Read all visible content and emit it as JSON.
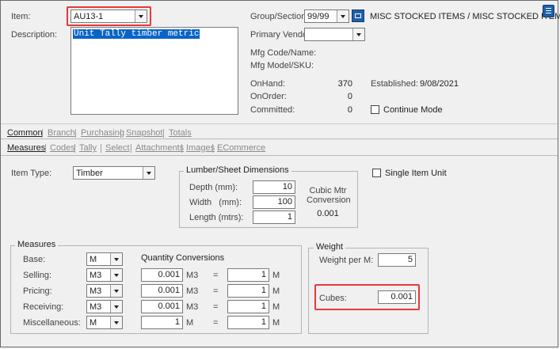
{
  "header": {
    "item_label": "Item:",
    "item_value": "AU13-1",
    "description_label": "Description:",
    "description_value": "Unit Tally timber metric",
    "group_label": "Group/Section:",
    "group_value": "99/99",
    "group_text": "MISC STOCKED ITEMS / MISC STOCKED ITEMS",
    "vendor_label": "Primary Vendor:",
    "vendor_value": "",
    "mfg_code_label": "Mfg Code/Name:",
    "mfg_model_label": "Mfg Model/SKU:",
    "onhand_label": "OnHand:",
    "onhand_value": "370",
    "onorder_label": "OnOrder:",
    "onorder_value": "0",
    "committed_label": "Committed:",
    "committed_value": "0",
    "established_label": "Established:",
    "established_value": "9/08/2021",
    "continue_mode_label": "Continue Mode"
  },
  "tabs_main": [
    "Common",
    "Branch",
    "Purchasing",
    "Snapshot",
    "Totals"
  ],
  "tabs_sub": [
    "Measures",
    "Codes",
    "Tally",
    "Select",
    "Attachments",
    "Images",
    "ECommerce"
  ],
  "item_type": {
    "label": "Item Type:",
    "value": "Timber"
  },
  "single_item_unit_label": "Single Item Unit",
  "lumber": {
    "title": "Lumber/Sheet Dimensions",
    "depth_label": "Depth (mm):",
    "depth_value": "10",
    "width_label": "Width   (mm):",
    "width_value": "100",
    "length_label": "Length (mtrs):",
    "length_value": "1",
    "cubic_label_1": "Cubic Mtr",
    "cubic_label_2": "Conversion",
    "cubic_value": "0.001"
  },
  "measures": {
    "title": "Measures",
    "qty_conv_label": "Quantity Conversions",
    "rows": [
      {
        "label": "Base:",
        "unit": "M",
        "qty": "",
        "qty_unit": "",
        "eq": "",
        "conv": "",
        "conv_unit": ""
      },
      {
        "label": "Selling:",
        "unit": "M3",
        "qty": "0.001",
        "qty_unit": "M3",
        "eq": "=",
        "conv": "1",
        "conv_unit": "M"
      },
      {
        "label": "Pricing:",
        "unit": "M3",
        "qty": "0.001",
        "qty_unit": "M3",
        "eq": "=",
        "conv": "1",
        "conv_unit": "M"
      },
      {
        "label": "Receiving:",
        "unit": "M3",
        "qty": "0.001",
        "qty_unit": "M3",
        "eq": "=",
        "conv": "1",
        "conv_unit": "M"
      },
      {
        "label": "Miscellaneous:",
        "unit": "M",
        "qty": "1",
        "qty_unit": "M",
        "eq": "=",
        "conv": "1",
        "conv_unit": "M"
      }
    ]
  },
  "weight": {
    "title": "Weight",
    "per_label": "Weight per M:",
    "per_value": "5",
    "cubes_label": "Cubes:",
    "cubes_value": "0.001"
  },
  "colors": {
    "highlight": "#e8393b",
    "selection": "#0a64c8",
    "accent": "#1f5fa8"
  },
  "icons": {
    "menu": "hamburger-icon",
    "group_lookup": "lookup-icon"
  }
}
